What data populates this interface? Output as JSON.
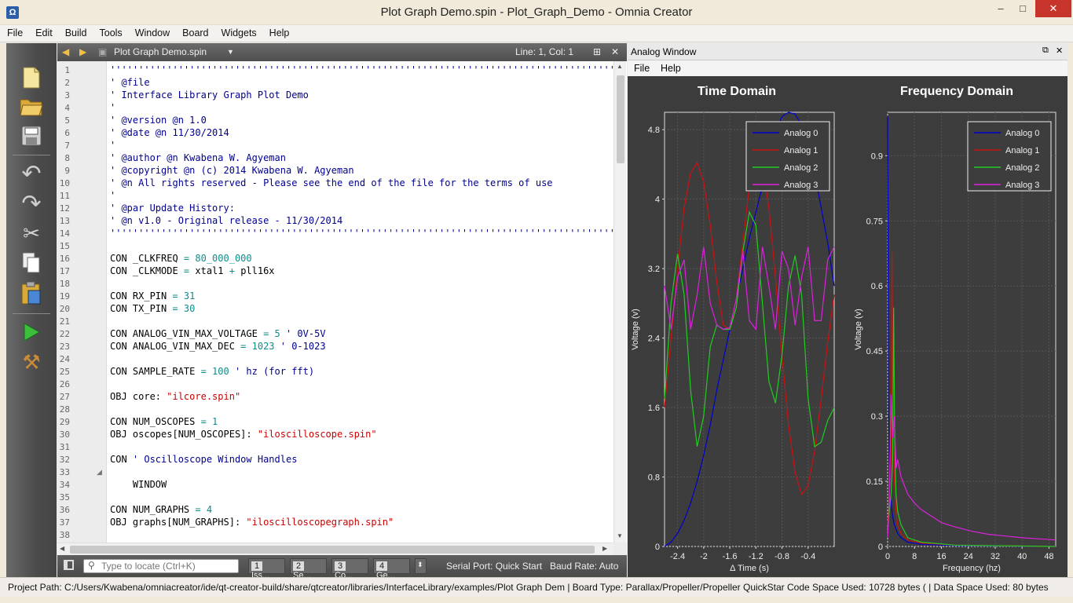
{
  "window": {
    "title": "Plot Graph Demo.spin - Plot_Graph_Demo - Omnia Creator",
    "app_icon": "omnia-icon",
    "controls": [
      "–",
      "□",
      "✕"
    ]
  },
  "menu": [
    "File",
    "Edit",
    "Build",
    "Tools",
    "Window",
    "Board",
    "Widgets",
    "Help"
  ],
  "toolbar": [
    {
      "name": "new-file-icon",
      "glyph": "🗋"
    },
    {
      "name": "open-folder-icon",
      "glyph": "📂"
    },
    {
      "name": "save-icon",
      "glyph": "💾"
    },
    {
      "name": "undo-icon",
      "glyph": "↶"
    },
    {
      "name": "redo-icon",
      "glyph": "↷"
    },
    {
      "name": "cut-icon",
      "glyph": "✂"
    },
    {
      "name": "copy-icon",
      "glyph": "❐"
    },
    {
      "name": "paste-icon",
      "glyph": "📋"
    },
    {
      "name": "run-icon",
      "glyph": "▶"
    },
    {
      "name": "build-hammer-icon",
      "glyph": "⚒"
    }
  ],
  "editor": {
    "file_name": "Plot Graph Demo.spin",
    "position": "Line: 1, Col: 1",
    "lines": [
      {
        "n": "1",
        "segs": [
          {
            "c": "cm",
            "t": "''''''''''''''''''''''''''''''''''''''''''''''''''''''''''''''''''''''''''''''''''''''''''''''''''''''''''''''"
          }
        ]
      },
      {
        "n": "2",
        "segs": [
          {
            "c": "cm",
            "t": "' @file"
          }
        ]
      },
      {
        "n": "3",
        "segs": [
          {
            "c": "cm",
            "t": "' Interface Library Graph Plot Demo"
          }
        ]
      },
      {
        "n": "4",
        "segs": [
          {
            "c": "cm",
            "t": "'"
          }
        ]
      },
      {
        "n": "5",
        "segs": [
          {
            "c": "cm",
            "t": "' @version @n 1.0"
          }
        ]
      },
      {
        "n": "6",
        "segs": [
          {
            "c": "cm",
            "t": "' @date @n 11/30/2014"
          }
        ]
      },
      {
        "n": "7",
        "segs": [
          {
            "c": "cm",
            "t": "'"
          }
        ]
      },
      {
        "n": "8",
        "segs": [
          {
            "c": "cm",
            "t": "' @author @n Kwabena W. Agyeman"
          }
        ]
      },
      {
        "n": "9",
        "segs": [
          {
            "c": "cm",
            "t": "' @copyright @n (c) 2014 Kwabena W. Agyeman"
          }
        ]
      },
      {
        "n": "10",
        "segs": [
          {
            "c": "cm",
            "t": "' @n All rights reserved - Please see the end of the file for the terms of use"
          }
        ]
      },
      {
        "n": "11",
        "segs": [
          {
            "c": "cm",
            "t": "'"
          }
        ]
      },
      {
        "n": "12",
        "segs": [
          {
            "c": "cm",
            "t": "' @par Update History:"
          }
        ]
      },
      {
        "n": "13",
        "segs": [
          {
            "c": "cm",
            "t": "' @n v1.0 - Original release - 11/30/2014"
          }
        ]
      },
      {
        "n": "14",
        "segs": [
          {
            "c": "cm",
            "t": "''''''''''''''''''''''''''''''''''''''''''''''''''''''''''''''''''''''''''''''''''''''''''''''''''''''''''''''"
          }
        ]
      },
      {
        "n": "15",
        "segs": []
      },
      {
        "n": "16",
        "segs": [
          {
            "c": "kw",
            "t": "CON _CLKFREQ "
          },
          {
            "c": "num",
            "t": "= 80_000_000"
          }
        ]
      },
      {
        "n": "17",
        "segs": [
          {
            "c": "kw",
            "t": "CON _CLKMODE "
          },
          {
            "c": "num",
            "t": "= "
          },
          {
            "c": "kw",
            "t": "xtal1 "
          },
          {
            "c": "num",
            "t": "+ "
          },
          {
            "c": "kw",
            "t": "pll16x"
          }
        ]
      },
      {
        "n": "18",
        "segs": []
      },
      {
        "n": "19",
        "segs": [
          {
            "c": "kw",
            "t": "CON RX_PIN "
          },
          {
            "c": "num",
            "t": "= 31"
          }
        ]
      },
      {
        "n": "20",
        "segs": [
          {
            "c": "kw",
            "t": "CON TX_PIN "
          },
          {
            "c": "num",
            "t": "= 30"
          }
        ]
      },
      {
        "n": "21",
        "segs": []
      },
      {
        "n": "22",
        "segs": [
          {
            "c": "kw",
            "t": "CON ANALOG_VIN_MAX_VOLTAGE "
          },
          {
            "c": "num",
            "t": "= 5 "
          },
          {
            "c": "cm",
            "t": "' 0V-5V"
          }
        ]
      },
      {
        "n": "23",
        "segs": [
          {
            "c": "kw",
            "t": "CON ANALOG_VIN_MAX_DEC "
          },
          {
            "c": "num",
            "t": "= 1023 "
          },
          {
            "c": "cm",
            "t": "' 0-1023"
          }
        ]
      },
      {
        "n": "24",
        "segs": []
      },
      {
        "n": "25",
        "segs": [
          {
            "c": "kw",
            "t": "CON SAMPLE_RATE "
          },
          {
            "c": "num",
            "t": "= 100 "
          },
          {
            "c": "cm",
            "t": "' hz (for fft)"
          }
        ]
      },
      {
        "n": "26",
        "segs": []
      },
      {
        "n": "27",
        "segs": [
          {
            "c": "kw",
            "t": "OBJ core: "
          },
          {
            "c": "str",
            "t": "\"ilcore.spin\""
          }
        ]
      },
      {
        "n": "28",
        "segs": []
      },
      {
        "n": "29",
        "segs": [
          {
            "c": "kw",
            "t": "CON NUM_OSCOPES "
          },
          {
            "c": "num",
            "t": "= 1"
          }
        ]
      },
      {
        "n": "30",
        "segs": [
          {
            "c": "kw",
            "t": "OBJ oscopes[NUM_OSCOPES]: "
          },
          {
            "c": "str",
            "t": "\"iloscilloscope.spin\""
          }
        ]
      },
      {
        "n": "31",
        "segs": []
      },
      {
        "n": "32",
        "segs": [
          {
            "c": "kw",
            "t": "CON "
          },
          {
            "c": "cm",
            "t": "' Oscilloscope Window Handles"
          }
        ]
      },
      {
        "n": "33",
        "segs": [],
        "fold": "◢"
      },
      {
        "n": "34",
        "segs": [
          {
            "c": "kw",
            "t": "    WINDOW"
          }
        ]
      },
      {
        "n": "35",
        "segs": []
      },
      {
        "n": "36",
        "segs": [
          {
            "c": "kw",
            "t": "CON NUM_GRAPHS "
          },
          {
            "c": "num",
            "t": "= 4"
          }
        ]
      },
      {
        "n": "37",
        "segs": [
          {
            "c": "kw",
            "t": "OBJ graphs[NUM_GRAPHS]: "
          },
          {
            "c": "str",
            "t": "\"iloscilloscopegraph.spin\""
          }
        ]
      },
      {
        "n": "38",
        "segs": []
      }
    ]
  },
  "bottom": {
    "locate_placeholder": "Type to locate (Ctrl+K)",
    "panes": [
      {
        "num": "1",
        "label": "Iss..."
      },
      {
        "num": "2",
        "label": "Se..."
      },
      {
        "num": "3",
        "label": "Co..."
      },
      {
        "num": "4",
        "label": "Ge..."
      }
    ],
    "serial_port": "Serial Port:  Quick Start",
    "baud_rate": "Baud Rate:  Auto"
  },
  "analog": {
    "title": "Analog Window",
    "menu": [
      "File",
      "Help"
    ],
    "colors": {
      "bg": "#3c3c3c",
      "plot": "#3d3d3d",
      "grid": "#555555"
    }
  },
  "status": {
    "text": "Project Path:  C:/Users/Kwabena/omniacreator/ide/qt-creator-build/share/qtcreator/libraries/InterfaceLibrary/examples/Plot Graph Dem  |  Board Type:  Parallax/Propeller/Propeller QuickStar  Code Space Used:  10728 bytes (  |  Data Space Used:  80 bytes"
  },
  "chart_data": [
    {
      "type": "line",
      "title": "Time Domain",
      "xlabel": "Δ Time (s)",
      "ylabel": "Voltage (v)",
      "xlim": [
        -2.6,
        0
      ],
      "ylim": [
        0,
        5.0
      ],
      "xticks": [
        "-2.4",
        "-2",
        "-1.6",
        "-1.2",
        "-0.8",
        "-0.4"
      ],
      "xtick_values": [
        -2.4,
        -2,
        -1.6,
        -1.2,
        -0.8,
        -0.4
      ],
      "yticks": [
        "0",
        "0.8",
        "1.6",
        "2.4",
        "3.2",
        "4",
        "4.8"
      ],
      "ytick_values": [
        0,
        0.8,
        1.6,
        2.4,
        3.2,
        4,
        4.8
      ],
      "grid": true,
      "legend": "top-right",
      "series": [
        {
          "name": "Analog 0",
          "color": "#0000cc",
          "x": [
            -2.6,
            -2.5,
            -2.4,
            -2.3,
            -2.2,
            -2.1,
            -2.0,
            -1.9,
            -1.8,
            -1.7,
            -1.6,
            -1.5,
            -1.4,
            -1.3,
            -1.2,
            -1.1,
            -1.0,
            -0.9,
            -0.8,
            -0.7,
            -0.6,
            -0.5,
            -0.4,
            -0.3,
            -0.2,
            -0.1,
            0.0
          ],
          "y": [
            0.0,
            0.05,
            0.15,
            0.3,
            0.5,
            0.75,
            1.05,
            1.4,
            1.8,
            2.15,
            2.5,
            2.85,
            3.2,
            3.55,
            3.85,
            4.15,
            4.45,
            4.75,
            4.95,
            5.0,
            4.98,
            4.85,
            4.6,
            4.3,
            3.9,
            3.5,
            3.0
          ]
        },
        {
          "name": "Analog 1",
          "color": "#cc1111",
          "x": [
            -2.6,
            -2.5,
            -2.4,
            -2.3,
            -2.2,
            -2.1,
            -2.0,
            -1.9,
            -1.8,
            -1.7,
            -1.6,
            -1.5,
            -1.4,
            -1.3,
            -1.2,
            -1.1,
            -1.0,
            -0.9,
            -0.8,
            -0.7,
            -0.6,
            -0.5,
            -0.4,
            -0.3,
            -0.2,
            -0.1,
            0.0
          ],
          "y": [
            1.6,
            2.4,
            3.2,
            3.9,
            4.3,
            4.42,
            4.2,
            3.7,
            3.05,
            2.55,
            2.5,
            2.85,
            3.5,
            4.15,
            4.5,
            4.4,
            3.9,
            3.1,
            2.2,
            1.4,
            0.85,
            0.6,
            0.7,
            1.1,
            1.7,
            2.35,
            2.9
          ]
        },
        {
          "name": "Analog 2",
          "color": "#22cc22",
          "x": [
            -2.6,
            -2.5,
            -2.4,
            -2.3,
            -2.2,
            -2.1,
            -2.0,
            -1.9,
            -1.8,
            -1.7,
            -1.6,
            -1.5,
            -1.4,
            -1.3,
            -1.2,
            -1.1,
            -1.0,
            -0.9,
            -0.8,
            -0.7,
            -0.6,
            -0.5,
            -0.4,
            -0.3,
            -0.2,
            -0.1,
            0.0
          ],
          "y": [
            1.7,
            2.8,
            3.37,
            2.9,
            1.8,
            1.15,
            1.5,
            2.3,
            2.55,
            2.5,
            2.5,
            2.75,
            3.4,
            3.85,
            3.7,
            2.8,
            1.9,
            1.65,
            2.2,
            3.0,
            3.35,
            2.9,
            1.7,
            1.15,
            1.2,
            1.45,
            1.6
          ]
        },
        {
          "name": "Analog 3",
          "color": "#dd22dd",
          "x": [
            -2.6,
            -2.5,
            -2.4,
            -2.3,
            -2.2,
            -2.1,
            -2.0,
            -1.9,
            -1.8,
            -1.7,
            -1.6,
            -1.5,
            -1.4,
            -1.3,
            -1.2,
            -1.1,
            -1.0,
            -0.9,
            -0.8,
            -0.7,
            -0.6,
            -0.5,
            -0.4,
            -0.3,
            -0.2,
            -0.1,
            0.0
          ],
          "y": [
            3.0,
            2.5,
            3.1,
            3.3,
            2.5,
            2.9,
            3.45,
            2.8,
            2.55,
            2.5,
            2.52,
            2.85,
            3.4,
            2.6,
            2.5,
            3.45,
            3.0,
            2.5,
            3.4,
            3.2,
            2.55,
            3.1,
            3.45,
            2.6,
            2.6,
            3.3,
            3.45
          ]
        }
      ]
    },
    {
      "type": "line",
      "title": "Frequency Domain",
      "xlabel": "Frequency (hz)",
      "ylabel": "Voltage (v)",
      "xlim": [
        0,
        50
      ],
      "ylim": [
        0,
        1.0
      ],
      "xticks": [
        "0",
        "8",
        "16",
        "24",
        "32",
        "40",
        "48"
      ],
      "xtick_values": [
        0,
        8,
        16,
        24,
        32,
        40,
        48
      ],
      "yticks": [
        "0",
        "0.15",
        "0.3",
        "0.45",
        "0.6",
        "0.75",
        "0.9"
      ],
      "ytick_values": [
        0,
        0.15,
        0.3,
        0.45,
        0.6,
        0.75,
        0.9
      ],
      "grid": true,
      "legend": "top-right",
      "series": [
        {
          "name": "Analog 0",
          "color": "#0000cc",
          "x": [
            0,
            0.3,
            0.6,
            1,
            1.5,
            2,
            3,
            4,
            6,
            10,
            20,
            50
          ],
          "y": [
            0.99,
            0.3,
            0.15,
            0.1,
            0.07,
            0.05,
            0.03,
            0.02,
            0.01,
            0.005,
            0.002,
            0.0
          ]
        },
        {
          "name": "Analog 1",
          "color": "#cc1111",
          "x": [
            0,
            0.5,
            1,
            1.3,
            1.6,
            2,
            2.5,
            3,
            4,
            6,
            10,
            20,
            50
          ],
          "y": [
            0.05,
            0.1,
            0.2,
            0.68,
            0.3,
            0.15,
            0.08,
            0.05,
            0.03,
            0.015,
            0.008,
            0.003,
            0.0
          ]
        },
        {
          "name": "Analog 2",
          "color": "#22cc22",
          "x": [
            0,
            0.5,
            1,
            1.5,
            1.8,
            2.1,
            2.5,
            3,
            4,
            6,
            10,
            20,
            50
          ],
          "y": [
            0.04,
            0.08,
            0.12,
            0.2,
            0.55,
            0.25,
            0.12,
            0.08,
            0.05,
            0.02,
            0.01,
            0.003,
            0.0
          ]
        },
        {
          "name": "Analog 3",
          "color": "#dd22dd",
          "x": [
            0,
            0.5,
            1,
            1.5,
            2,
            2.5,
            3,
            4,
            5,
            6,
            8,
            10,
            13,
            16,
            20,
            25,
            30,
            40,
            50
          ],
          "y": [
            0.02,
            0.1,
            0.35,
            0.25,
            0.3,
            0.18,
            0.2,
            0.16,
            0.14,
            0.12,
            0.1,
            0.085,
            0.07,
            0.055,
            0.045,
            0.035,
            0.028,
            0.02,
            0.015
          ]
        }
      ]
    }
  ]
}
